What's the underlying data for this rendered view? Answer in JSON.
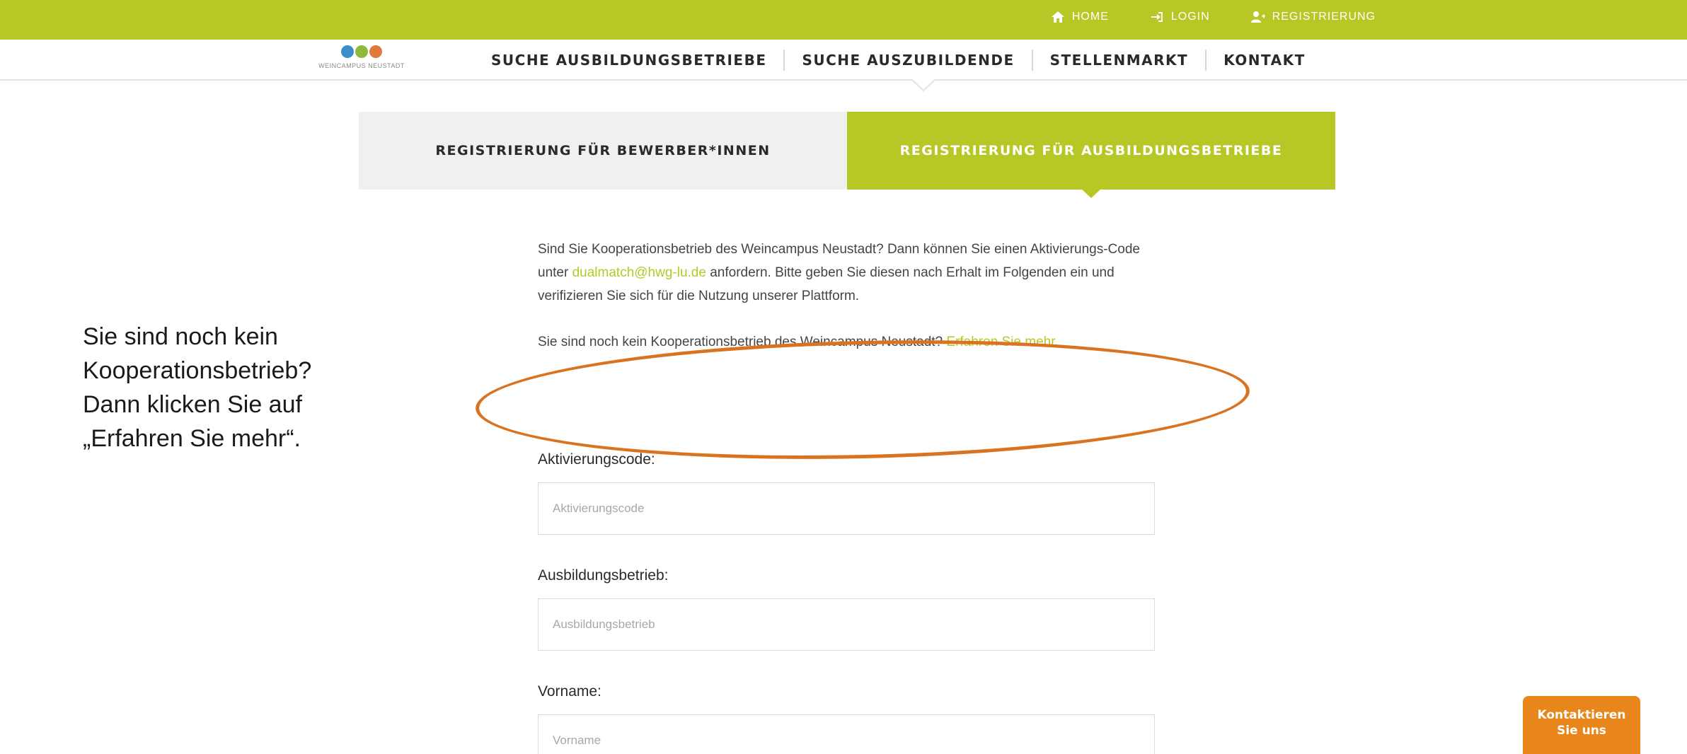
{
  "topnav": {
    "home": "HOME",
    "login": "LOGIN",
    "register": "REGISTRIERUNG"
  },
  "logo": {
    "tagline": "WEINCAMPUS NEUSTADT",
    "colors": [
      "#3b8fc8",
      "#8dba3c",
      "#e07a3a"
    ]
  },
  "mainnav": [
    "SUCHE AUSBILDUNGSBETRIEBE",
    "SUCHE AUSZUBILDENDE",
    "STELLENMARKT",
    "KONTAKT"
  ],
  "tabs": {
    "applicants": "REGISTRIERUNG FÜR BEWERBER*INNEN",
    "companies": "REGISTRIERUNG FÜR AUSBILDUNGSBETRIEBE"
  },
  "intro": {
    "text_before": "Sind Sie Kooperationsbetrieb des Weincampus Neustadt? Dann können Sie einen Aktivierungs-Code unter ",
    "email": "dualmatch@hwg-lu.de",
    "text_after": " anfordern. Bitte geben Sie diesen nach Erhalt im Folgenden ein und verifizieren Sie sich für die Nutzung unserer Plattform."
  },
  "cooperation": {
    "text": "Sie sind noch kein Kooperationsbetrieb des Weincampus Neustadt? ",
    "link": "Erfahren Sie mehr."
  },
  "side_note": {
    "line1": "Sie sind noch kein",
    "line2": "Kooperationsbetrieb?",
    "line3": "Dann klicken Sie auf",
    "line4": "„Erfahren Sie mehr“."
  },
  "form": {
    "activation": {
      "label": "Aktivierungscode:",
      "placeholder": "Aktivierungscode"
    },
    "company": {
      "label": "Ausbildungsbetrieb:",
      "placeholder": "Ausbildungsbetrieb"
    },
    "firstname": {
      "label": "Vorname:",
      "placeholder": "Vorname"
    }
  },
  "contact_button": {
    "line1": "Kontaktieren",
    "line2": "Sie uns"
  },
  "colors": {
    "brand_green": "#b7c826",
    "accent_orange": "#e8861c",
    "annotation_orange": "#d9731f"
  }
}
